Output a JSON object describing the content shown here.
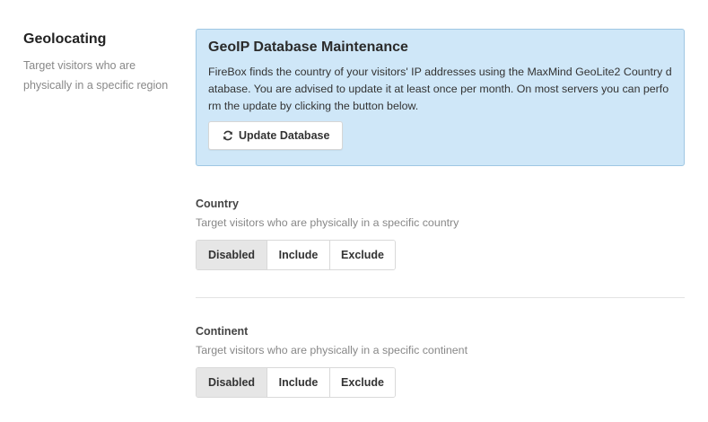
{
  "section": {
    "title": "Geolocating",
    "description": "Target visitors who are physically in a specific region"
  },
  "alert": {
    "title": "GeoIP Database Maintenance",
    "text": "FireBox finds the country of your visitors' IP addresses using the MaxMind GeoLite2 Country database. You are advised to update it at least once per month. On most servers you can perform the update by clicking the button below.",
    "button_label": "Update Database",
    "button_icon": "refresh-icon"
  },
  "country": {
    "label": "Country",
    "description": "Target visitors who are physically in a specific country",
    "options": [
      "Disabled",
      "Include",
      "Exclude"
    ],
    "selected": "Disabled"
  },
  "continent": {
    "label": "Continent",
    "description": "Target visitors who are physically in a specific continent",
    "options": [
      "Disabled",
      "Include",
      "Exclude"
    ],
    "selected": "Disabled"
  },
  "colors": {
    "alert_bg": "#cfe7f8",
    "alert_border": "#9fc7e3",
    "active_segment": "#e6e6e6"
  }
}
